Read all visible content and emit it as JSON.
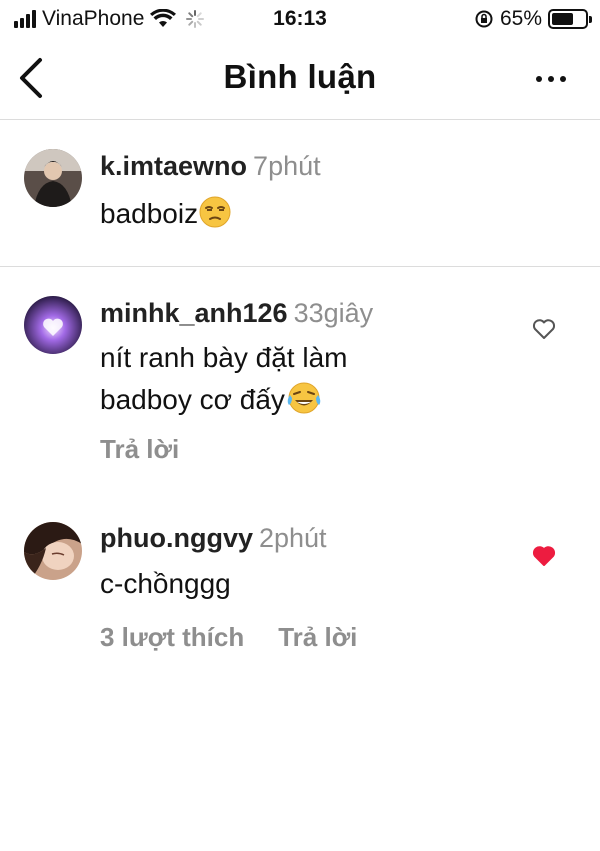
{
  "status_bar": {
    "carrier": "VinaPhone",
    "time": "16:13",
    "battery": "65%",
    "battery_level": 0.65
  },
  "header": {
    "title": "Bình luận"
  },
  "caption": {
    "username": "k.imtaewno",
    "time": "7phút",
    "text": "badboiz",
    "emoji": "unamused-face-emoji"
  },
  "comments": [
    {
      "username": "minhk_anh126",
      "time": "33giây",
      "text_line1": "nít ranh bày đặt làm",
      "text_line2": "badboy cơ đấy",
      "emoji": "tears-of-joy-emoji",
      "reply_label": "Trả lời",
      "liked": false
    },
    {
      "username": "phuo.nggvy",
      "time": "2phút",
      "text": "c-chồnggg",
      "likes_label": "3 lượt thích",
      "reply_label": "Trả lời",
      "liked": true
    }
  ],
  "colors": {
    "heart_liked": "#ed1c40",
    "muted_text": "#8e8e8e",
    "divider": "#dcdcdc"
  }
}
